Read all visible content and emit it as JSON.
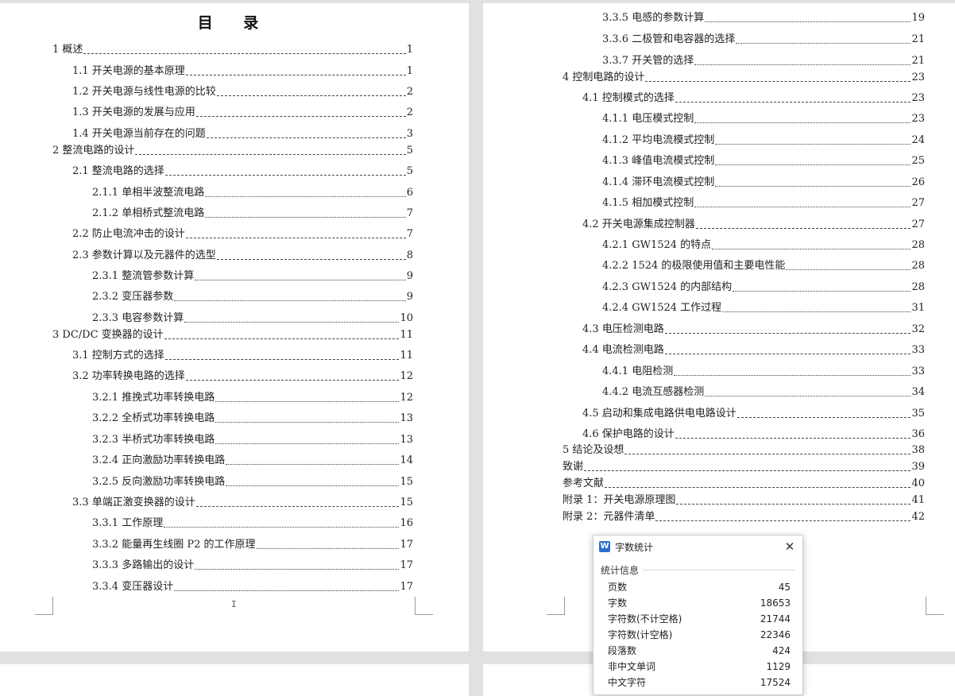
{
  "toc": {
    "title": "目 录",
    "left": [
      {
        "label": "1 概述",
        "page": "1"
      },
      {
        "label": "1.1 开关电源的基本原理",
        "page": "1"
      },
      {
        "label": "1.2 开关电源与线性电源的比较",
        "page": "2"
      },
      {
        "label": "1.3 开关电源的发展与应用",
        "page": "2"
      },
      {
        "label": "1.4 开关电源当前存在的问题",
        "page": "3"
      },
      {
        "label": "2 整流电路的设计",
        "page": "5"
      },
      {
        "label": "2.1 整流电路的选择",
        "page": "5"
      },
      {
        "label": "2.1.1 单相半波整流电路",
        "page": "6"
      },
      {
        "label": "2.1.2 单相桥式整流电路",
        "page": "7"
      },
      {
        "label": "2.2 防止电流冲击的设计",
        "page": "7"
      },
      {
        "label": "2.3 参数计算以及元器件的选型",
        "page": "8"
      },
      {
        "label": "2.3.1 整流管参数计算",
        "page": "9"
      },
      {
        "label": "2.3.2 变压器参数",
        "page": "9"
      },
      {
        "label": "2.3.3 电容参数计算",
        "page": "10"
      },
      {
        "label": "3 DC/DC 变换器的设计",
        "page": "11"
      },
      {
        "label": "3.1 控制方式的选择",
        "page": "11"
      },
      {
        "label": "3.2 功率转换电路的选择",
        "page": "12"
      },
      {
        "label": "3.2.1 推挽式功率转换电路",
        "page": "12"
      },
      {
        "label": "3.2.2 全桥式功率转换电路",
        "page": "13"
      },
      {
        "label": "3.2.3 半桥式功率转换电路",
        "page": "13"
      },
      {
        "label": "3.2.4 正向激励功率转换电路",
        "page": "14"
      },
      {
        "label": "3.2.5 反向激励功率转换电路",
        "page": "15"
      },
      {
        "label": "3.3 单端正激变换器的设计",
        "page": "15"
      },
      {
        "label": "3.3.1 工作原理",
        "page": "16"
      },
      {
        "label": "3.3.2 能量再生线圈 P2 的工作原理",
        "page": "17"
      },
      {
        "label": "3.3.3 多路输出的设计",
        "page": "17"
      },
      {
        "label": "3.3.4 变压器设计",
        "page": "17"
      }
    ],
    "right": [
      {
        "label": "3.3.5 电感的参数计算",
        "page": "19"
      },
      {
        "label": "3.3.6 二极管和电容器的选择",
        "page": "21"
      },
      {
        "label": "3.3.7 开关管的选择",
        "page": "21"
      },
      {
        "label": "4 控制电路的设计",
        "page": "23"
      },
      {
        "label": "4.1 控制模式的选择",
        "page": "23"
      },
      {
        "label": "4.1.1 电压模式控制",
        "page": "23"
      },
      {
        "label": "4.1.2 平均电流模式控制",
        "page": "24"
      },
      {
        "label": "4.1.3 峰值电流模式控制",
        "page": "25"
      },
      {
        "label": "4.1.4 滞环电流模式控制",
        "page": "26"
      },
      {
        "label": "4.1.5 相加模式控制",
        "page": "27"
      },
      {
        "label": "4.2 开关电源集成控制器",
        "page": "27"
      },
      {
        "label": "4.2.1 GW1524 的特点",
        "page": "28"
      },
      {
        "label": "4.2.2 1524 的极限使用值和主要电性能",
        "page": "28"
      },
      {
        "label": "4.2.3 GW1524 的内部结构",
        "page": "28"
      },
      {
        "label": "4.2.4 GW1524 工作过程",
        "page": "31"
      },
      {
        "label": "4.3 电压检测电路",
        "page": "32"
      },
      {
        "label": "4.4 电流检测电路",
        "page": "33"
      },
      {
        "label": "4.4.1 电阻检测",
        "page": "33"
      },
      {
        "label": "4.4.2 电流互感器检测",
        "page": "34"
      },
      {
        "label": "4.5 启动和集成电路供电电路设计",
        "page": "35"
      },
      {
        "label": "4.6 保护电路的设计",
        "page": "36"
      },
      {
        "label": "5 结论及设想",
        "page": "38"
      },
      {
        "label": "致谢",
        "page": "39"
      },
      {
        "label": "参考文献",
        "page": "40"
      },
      {
        "label": "附录 1：开关电源原理图",
        "page": "41"
      },
      {
        "label": "附录 2：元器件清单",
        "page": "42"
      }
    ]
  },
  "cursor_glyph": "I",
  "word_count": {
    "title": "字数统计",
    "logo_letter": "W",
    "close_glyph": "✕",
    "section": "统计信息",
    "rows": [
      {
        "label": "页数",
        "value": "45"
      },
      {
        "label": "字数",
        "value": "18653"
      },
      {
        "label": "字符数(不计空格)",
        "value": "21744"
      },
      {
        "label": "字符数(计空格)",
        "value": "22346"
      },
      {
        "label": "段落数",
        "value": "424"
      },
      {
        "label": "非中文单词",
        "value": "1129"
      },
      {
        "label": "中文字符",
        "value": "17524"
      }
    ]
  }
}
